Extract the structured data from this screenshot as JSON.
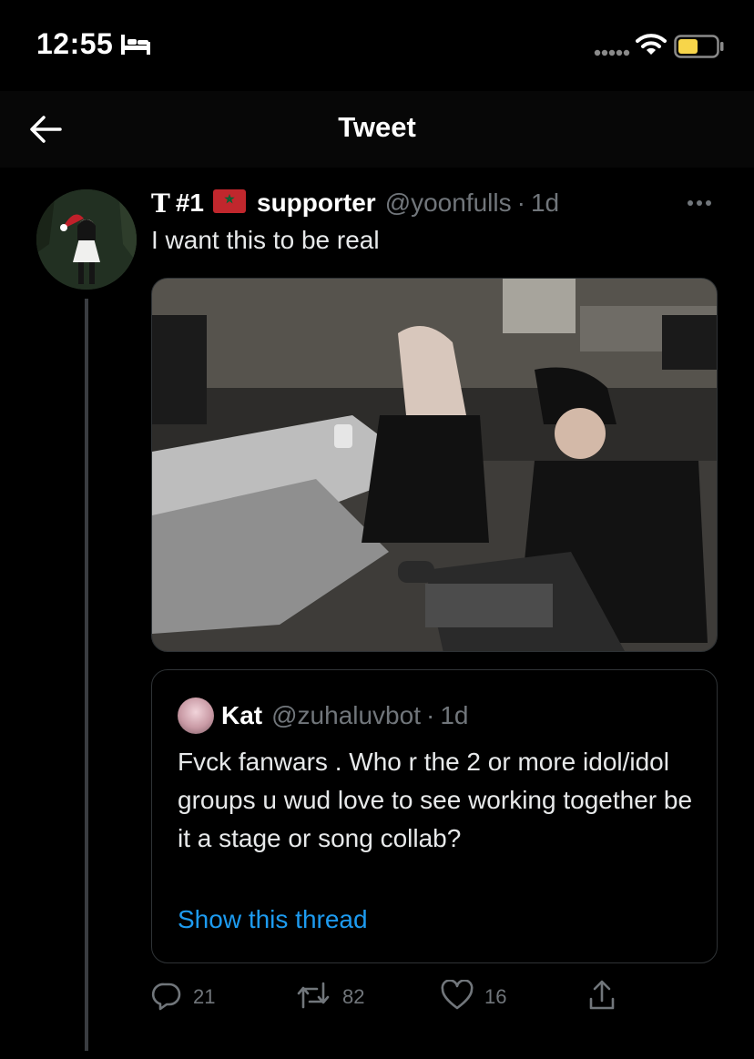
{
  "status_bar": {
    "time": "12:55",
    "icons": [
      "bed-icon",
      "signal-icon",
      "wifi-icon",
      "battery-icon"
    ]
  },
  "header": {
    "title": "Tweet",
    "back_icon": "arrow-left-icon"
  },
  "tweet": {
    "name_prefix": "T",
    "name_rank": "#1",
    "flag_icon": "morocco-flag-icon",
    "display_name": "supporter",
    "handle": "@yoonfulls",
    "separator": "·",
    "time": "1d",
    "text": "I want this to be real",
    "more_icon": "more-horizontal-icon"
  },
  "quote": {
    "display_name": "Kat",
    "handle": "@zuhaluvbot",
    "separator": "·",
    "time": "1d",
    "text": "Fvck fanwars . Who r the 2 or more idol/idol groups u wud  love to see working together be it a stage or song collab?",
    "show_thread": "Show this thread"
  },
  "actions": {
    "reply_count": "21",
    "retweet_count": "82",
    "like_count": "16"
  },
  "colors": {
    "background": "#000000",
    "text": "#e7e9ea",
    "muted": "#71767b",
    "link": "#1d9bf0",
    "border": "#2f3336",
    "battery": "#f7d54a"
  }
}
